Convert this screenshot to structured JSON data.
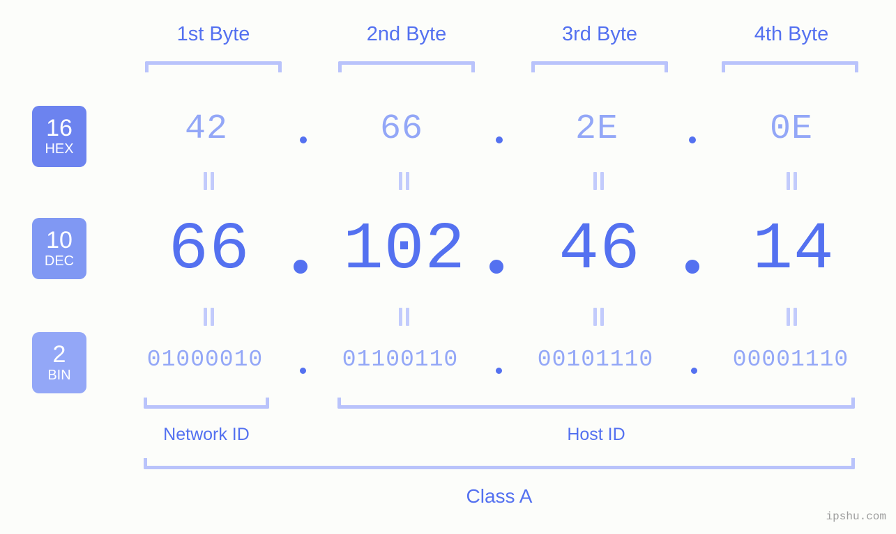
{
  "page": {
    "background_color": "#fcfdfa",
    "accent_color": "#5471f0",
    "light_accent_color": "#93a7f7",
    "bracket_color": "#b9c3fb",
    "watermark": "ipshu.com"
  },
  "byte_headers": [
    {
      "label": "1st Byte"
    },
    {
      "label": "2nd Byte"
    },
    {
      "label": "3rd Byte"
    },
    {
      "label": "4th Byte"
    }
  ],
  "rows": [
    {
      "radix_number": "16",
      "radix_name": "HEX",
      "badge_color": "#6c83ef",
      "values": [
        "42",
        "66",
        "2E",
        "0E"
      ]
    },
    {
      "radix_number": "10",
      "radix_name": "DEC",
      "badge_color": "#8098f3",
      "values": [
        "66",
        "102",
        "46",
        "14"
      ]
    },
    {
      "radix_number": "2",
      "radix_name": "BIN",
      "badge_color": "#93a7f7",
      "values": [
        "01000010",
        "01100110",
        "00101110",
        "00001110"
      ]
    }
  ],
  "separators": {
    "hex": ".",
    "dec": ".",
    "bin": "."
  },
  "equality_marks": {
    "symbol": "=",
    "count_per_gap": 4
  },
  "segments": {
    "network_id_label": "Network ID",
    "host_id_label": "Host ID"
  },
  "class": {
    "label": "Class A"
  }
}
